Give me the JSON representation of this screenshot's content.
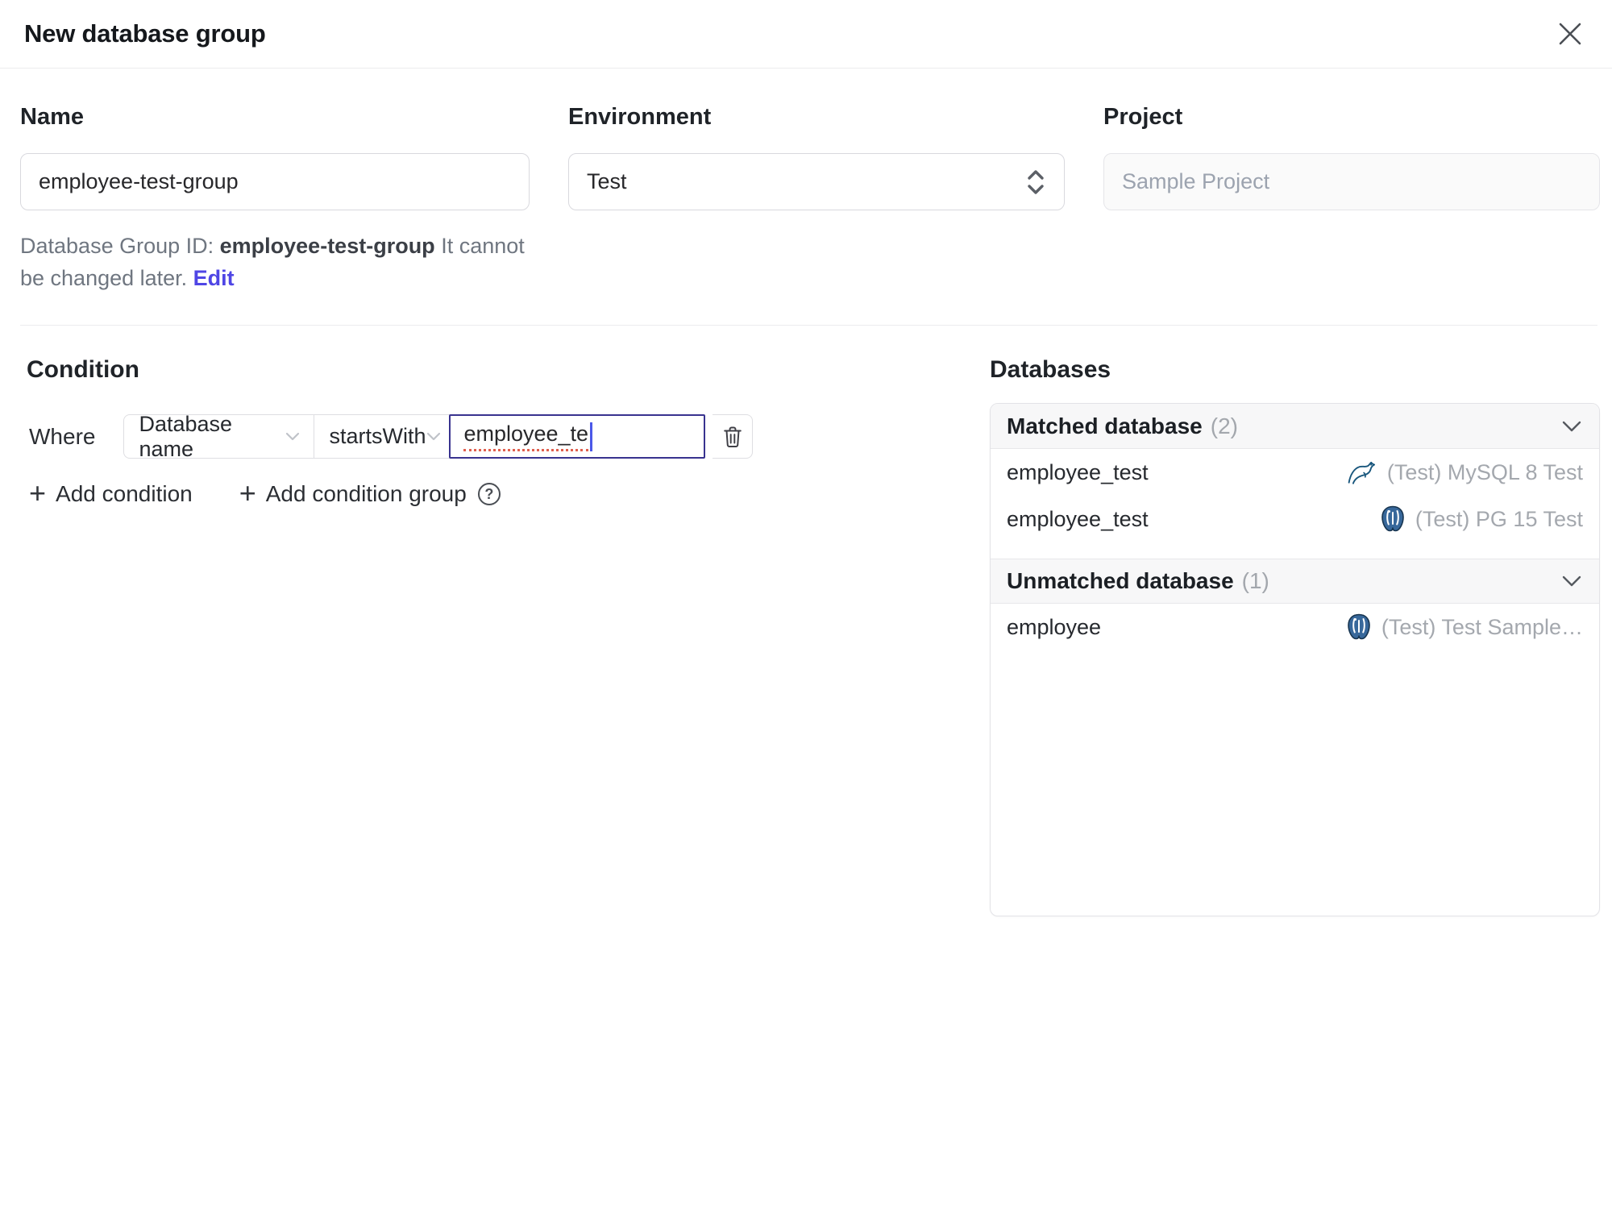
{
  "dialog": {
    "title": "New database group"
  },
  "form": {
    "name": {
      "label": "Name",
      "value": "employee-test-group"
    },
    "environment": {
      "label": "Environment",
      "value": "Test"
    },
    "project": {
      "label": "Project",
      "value": "Sample Project"
    },
    "id_help": {
      "prefix": "Database Group ID: ",
      "id": "employee-test-group",
      "suffix": " It cannot be changed later. ",
      "edit_label": "Edit"
    }
  },
  "condition": {
    "heading": "Condition",
    "where_label": "Where",
    "field_select_value": "Database name",
    "operator_select_value": "startsWith",
    "value_input": "employee_te",
    "add_condition_label": "Add condition",
    "add_condition_group_label": "Add condition group",
    "plus_glyph": "+",
    "help_glyph": "?"
  },
  "databases": {
    "heading": "Databases",
    "matched": {
      "title": "Matched database",
      "count": "(2)",
      "rows": [
        {
          "name": "employee_test",
          "engine": "mysql",
          "instance": "(Test) MySQL 8 Test"
        },
        {
          "name": "employee_test",
          "engine": "postgres",
          "instance": "(Test) PG 15 Test"
        }
      ]
    },
    "unmatched": {
      "title": "Unmatched database",
      "count": "(1)",
      "rows": [
        {
          "name": "employee",
          "engine": "postgres",
          "instance": "(Test) Test Sample…"
        }
      ]
    }
  },
  "colors": {
    "accent": "#4f46e5",
    "focus_border": "#39338f",
    "mysql_icon": "#19577d",
    "postgres_icon": "#38689b",
    "spellcheck_underline": "#e0604f"
  }
}
